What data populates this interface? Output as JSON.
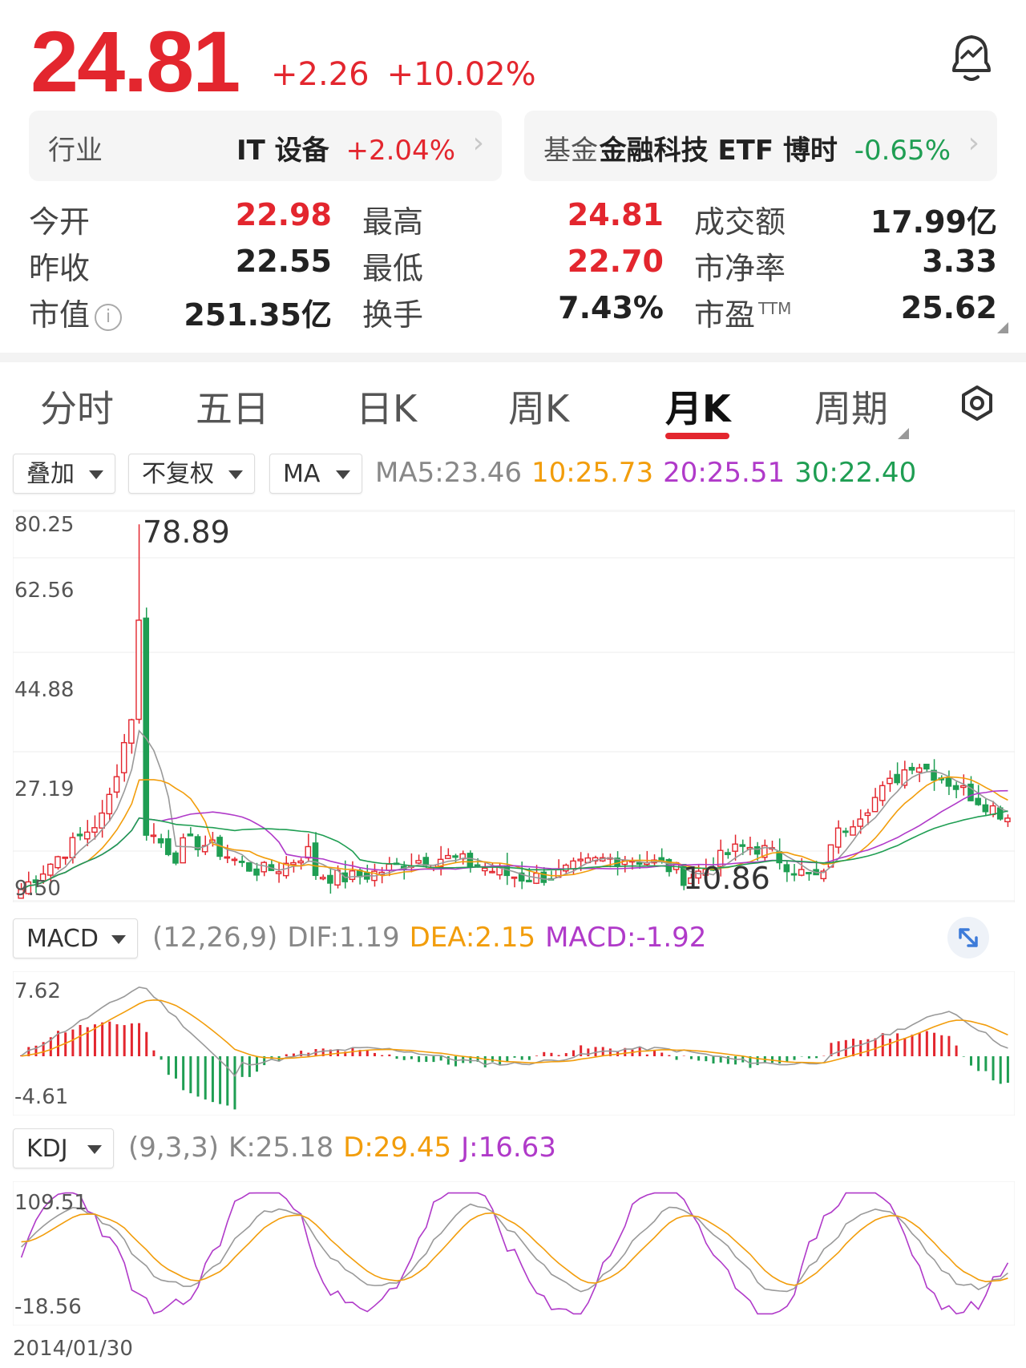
{
  "quote": {
    "price": "24.81",
    "change": "+2.26",
    "change_pct": "+10.02%"
  },
  "industry": {
    "label": "行业",
    "name": "IT 设备",
    "pct": "+2.04%"
  },
  "fund": {
    "label": "基金",
    "name": "金融科技 ETF 博时",
    "pct": "-0.65%"
  },
  "stats": {
    "open_label": "今开",
    "open": "22.98",
    "high_label": "最高",
    "high": "24.81",
    "amount_label": "成交额",
    "amount": "17.99亿",
    "prev_label": "昨收",
    "prev": "22.55",
    "low_label": "最低",
    "low": "22.70",
    "pb_label": "市净率",
    "pb": "3.33",
    "mcap_label": "市值",
    "mcap": "251.35亿",
    "turnover_label": "换手",
    "turnover": "7.43%",
    "pe_label": "市盈",
    "pe_sup": "TTM",
    "pe": "25.62"
  },
  "tabs": [
    "分时",
    "五日",
    "日K",
    "周K",
    "月K",
    "周期"
  ],
  "active_tab": "月K",
  "toolbar": {
    "overlay": "叠加",
    "adjust": "不复权",
    "ma": "MA",
    "ma5": "MA5:23.46",
    "ma10": "10:25.73",
    "ma20": "20:25.51",
    "ma30": "30:22.40"
  },
  "main_chart": {
    "y_labels": [
      "80.25",
      "62.56",
      "44.88",
      "27.19",
      "9.50"
    ],
    "max_label": "78.89",
    "min_label": "10.86"
  },
  "macd": {
    "select": "MACD",
    "params": "(12,26,9)",
    "dif": "DIF:1.19",
    "dea": "DEA:2.15",
    "macd": "MACD:-1.92",
    "y_top": "7.62",
    "y_bottom": "-4.61"
  },
  "kdj": {
    "select": "KDJ",
    "params": "(9,3,3)",
    "k": "K:25.18",
    "d": "D:29.45",
    "j": "J:16.63",
    "y_top": "109.51",
    "y_bottom": "-18.56"
  },
  "footer": {
    "date": "2014/01/30"
  },
  "colors": {
    "up": "#e3262e",
    "down": "#1f9e53",
    "ma10": "#f29d0b",
    "ma20": "#b03ac9",
    "ma30": "#1f9e53"
  },
  "icons": {
    "bell": "bell-chart-icon",
    "gear": "settings-gear-icon",
    "expand": "expand-arrows-icon",
    "info": "info-icon"
  }
}
